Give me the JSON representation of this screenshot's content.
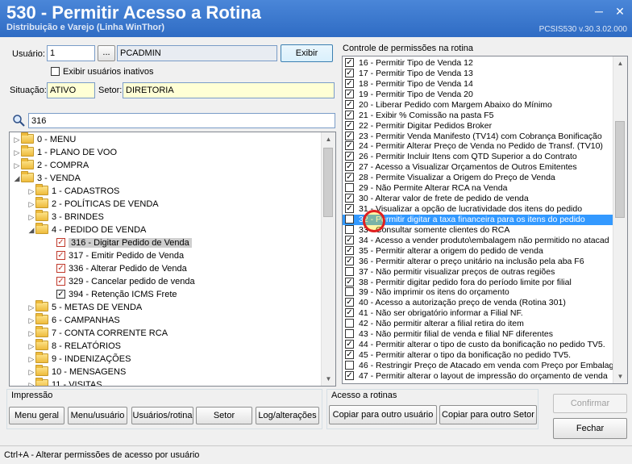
{
  "window": {
    "title": "530 - Permitir Acesso a Rotina",
    "subtitle": "Distribuição e Varejo (Linha WinThor)",
    "version": "PCSIS530  v.30.3.02.000",
    "minimize": "─",
    "close": "✕"
  },
  "user": {
    "label": "Usuário:",
    "id": "1",
    "lookup": "...",
    "name": "PCADMIN",
    "exibir_button": "Exibir",
    "inactive_label": "Exibir usuários inativos"
  },
  "situacao": {
    "label": "Situação:",
    "value": "ATIVO"
  },
  "setor": {
    "label": "Setor:",
    "value": "DIRETORIA"
  },
  "search": {
    "value": "316"
  },
  "tree": [
    {
      "level": 0,
      "arrow": "▷",
      "label": "0 - MENU",
      "type": "folder"
    },
    {
      "level": 0,
      "arrow": "▷",
      "label": "1 - PLANO DE VOO",
      "type": "folder"
    },
    {
      "level": 0,
      "arrow": "▷",
      "label": "2 - COMPRA",
      "type": "folder"
    },
    {
      "level": 0,
      "arrow": "◢",
      "label": "3 - VENDA",
      "type": "folder"
    },
    {
      "level": 1,
      "arrow": "▷",
      "label": "1 - CADASTROS",
      "type": "folder"
    },
    {
      "level": 1,
      "arrow": "▷",
      "label": "2 - POLÍTICAS DE VENDA",
      "type": "folder"
    },
    {
      "level": 1,
      "arrow": "▷",
      "label": "3 - BRINDES",
      "type": "folder"
    },
    {
      "level": 1,
      "arrow": "◢",
      "label": "4 - PEDIDO DE VENDA",
      "type": "folder"
    },
    {
      "level": 2,
      "arrow": "",
      "label": "316 - Digitar Pedido de Venda",
      "type": "check-red",
      "selected": true
    },
    {
      "level": 2,
      "arrow": "",
      "label": "317 - Emitir Pedido de Venda",
      "type": "check-red"
    },
    {
      "level": 2,
      "arrow": "",
      "label": "336 - Alterar Pedido de Venda",
      "type": "check-red"
    },
    {
      "level": 2,
      "arrow": "",
      "label": "329 - Cancelar pedido de venda",
      "type": "check-red"
    },
    {
      "level": 2,
      "arrow": "",
      "label": "394 - Retenção ICMS Frete",
      "type": "check"
    },
    {
      "level": 1,
      "arrow": "▷",
      "label": "5 - METAS DE VENDA",
      "type": "folder"
    },
    {
      "level": 1,
      "arrow": "▷",
      "label": "6 - CAMPANHAS",
      "type": "folder"
    },
    {
      "level": 1,
      "arrow": "▷",
      "label": "7 - CONTA CORRENTE RCA",
      "type": "folder"
    },
    {
      "level": 1,
      "arrow": "▷",
      "label": "8 - RELATÓRIOS",
      "type": "folder"
    },
    {
      "level": 1,
      "arrow": "▷",
      "label": "9 - INDENIZAÇÕES",
      "type": "folder"
    },
    {
      "level": 1,
      "arrow": "▷",
      "label": "10 - MENSAGENS",
      "type": "folder"
    },
    {
      "level": 1,
      "arrow": "▷",
      "label": "11 - VISITAS",
      "type": "folder"
    }
  ],
  "permissions_title": "Controle de permissões na rotina",
  "permissions": [
    {
      "label": "16 - Permitir Tipo de Venda 12",
      "checked": true
    },
    {
      "label": "17 - Permitir Tipo de Venda 13",
      "checked": true
    },
    {
      "label": "18 - Permitir Tipo de Venda 14",
      "checked": true
    },
    {
      "label": "19 - Permitir Tipo de Venda 20",
      "checked": true
    },
    {
      "label": "20 - Liberar Pedido com Margem Abaixo do Mínimo",
      "checked": true
    },
    {
      "label": "21 - Exibir % Comissão na pasta F5",
      "checked": true
    },
    {
      "label": "22 - Permitir Digitar Pedidos Broker",
      "checked": true
    },
    {
      "label": "23 - Permitir Venda Manifesto (TV14) com Cobrança Bonificação",
      "checked": true
    },
    {
      "label": "24 - Permitir Alterar Preço de Venda no Pedido de Transf. (TV10)",
      "checked": true
    },
    {
      "label": "26 - Permitir Incluir Itens com QTD Superior a do Contrato",
      "checked": true
    },
    {
      "label": "27 - Acesso a Visualizar Orçamentos de Outros Emitentes",
      "checked": true
    },
    {
      "label": "28 - Permite Visualizar a Origem do Preço de Venda",
      "checked": true
    },
    {
      "label": "29 - Não Permite Alterar RCA na Venda",
      "checked": false
    },
    {
      "label": "30 - Alterar valor de frete de pedido de venda",
      "checked": true
    },
    {
      "label": "31 - Visualizar a opção de lucratividade dos itens do pedido",
      "checked": true
    },
    {
      "label": "32 - Permitir digitar a taxa financeira para os itens do pedido",
      "checked": false,
      "selected": true
    },
    {
      "label": "33 - Consultar somente clientes do RCA",
      "checked": false
    },
    {
      "label": "34 - Acesso a vender produto\\embalagem não permitido no atacad",
      "checked": true
    },
    {
      "label": "35 - Permitir alterar a origem do pedido de venda",
      "checked": true
    },
    {
      "label": "36 - Permitir alterar o preço unitário na inclusão pela aba F6",
      "checked": true
    },
    {
      "label": "37 - Não permitir visualizar preços de outras regiões",
      "checked": false
    },
    {
      "label": "38 - Permitir digitar pedido fora do período limite por filial",
      "checked": true
    },
    {
      "label": "39 - Não imprimir os itens do orçamento",
      "checked": false
    },
    {
      "label": "40 - Acesso a autorização preço de venda (Rotina 301)",
      "checked": true
    },
    {
      "label": "41 - Não ser obrigatório informar a Filial NF.",
      "checked": true
    },
    {
      "label": "42 - Não permitir alterar a filial retira do item",
      "checked": false
    },
    {
      "label": "43 - Não permitir filial de venda e filial NF diferentes",
      "checked": false
    },
    {
      "label": "44 - Permitir alterar o tipo de custo da bonificação no pedido TV5.",
      "checked": true
    },
    {
      "label": "45 - Permitir alterar o tipo da bonificação no pedido TV5.",
      "checked": true
    },
    {
      "label": "46 - Restringir Preço de Atacado em venda com Preço por Embalag",
      "checked": false
    },
    {
      "label": "47 - Permitir alterar o layout de impressão do orçamento de venda",
      "checked": true
    }
  ],
  "impressao": {
    "title": "Impressão",
    "buttons": [
      "Menu geral",
      "Menu/usuário",
      "Usuários/rotina",
      "Setor",
      "Log/alterações"
    ]
  },
  "acesso": {
    "title": "Acesso a rotinas",
    "buttons": [
      "Copiar para outro usuário",
      "Copiar para outro Setor"
    ]
  },
  "confirm_button": "Confirmar",
  "close_button": "Fechar",
  "status": "Ctrl+A - Alterar permissões de acesso por usuário",
  "colors": {
    "selection": "#3399ff",
    "title_bar": "#2f6cc4",
    "required_field": "#ffffd5"
  }
}
